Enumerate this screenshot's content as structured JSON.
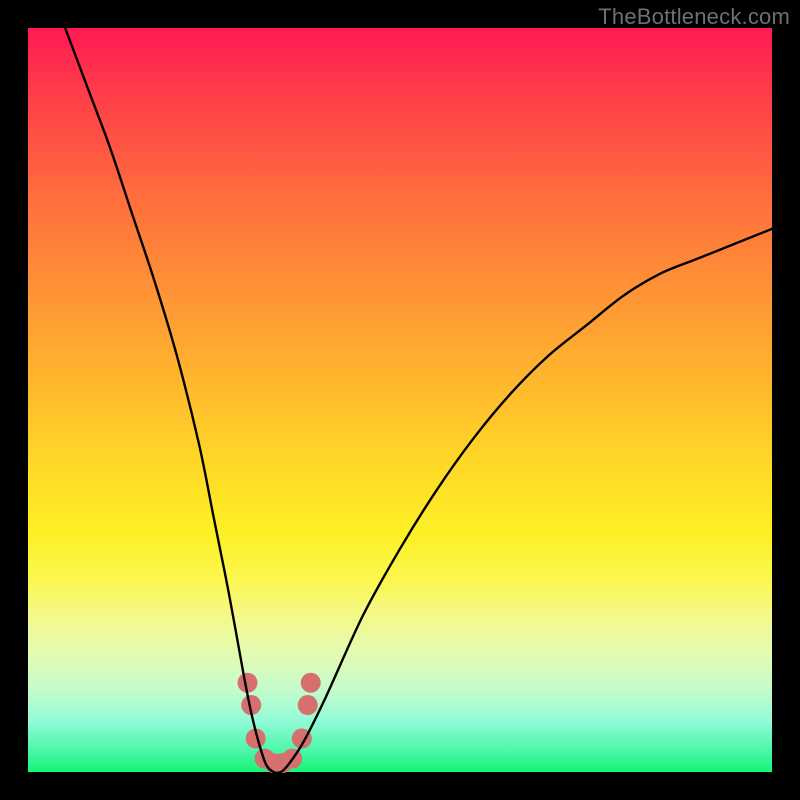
{
  "watermark": "TheBottleneck.com",
  "chart_data": {
    "type": "line",
    "title": "",
    "xlabel": "",
    "ylabel": "",
    "xlim": [
      0,
      100
    ],
    "ylim": [
      0,
      100
    ],
    "series": [
      {
        "name": "bottleneck-curve",
        "x": [
          5,
          8,
          11,
          14,
          17,
          20,
          23,
          25,
          27,
          29,
          30,
          31,
          32,
          33,
          34,
          35,
          37,
          40,
          45,
          50,
          55,
          60,
          65,
          70,
          75,
          80,
          85,
          90,
          95,
          100
        ],
        "y": [
          100,
          92,
          84,
          75,
          66,
          56,
          44,
          34,
          24,
          13,
          8,
          4,
          1,
          0,
          0,
          1,
          4,
          10,
          21,
          30,
          38,
          45,
          51,
          56,
          60,
          64,
          67,
          69,
          71,
          73
        ]
      }
    ],
    "markers": {
      "name": "highlight-dots",
      "color": "#d6706f",
      "points": [
        {
          "x": 29.5,
          "y": 12
        },
        {
          "x": 30.0,
          "y": 9
        },
        {
          "x": 30.6,
          "y": 4.5
        },
        {
          "x": 31.8,
          "y": 1.8
        },
        {
          "x": 33.0,
          "y": 1.2
        },
        {
          "x": 34.2,
          "y": 1.2
        },
        {
          "x": 35.5,
          "y": 1.8
        },
        {
          "x": 36.8,
          "y": 4.5
        },
        {
          "x": 37.6,
          "y": 9
        },
        {
          "x": 38.0,
          "y": 12
        }
      ]
    }
  }
}
